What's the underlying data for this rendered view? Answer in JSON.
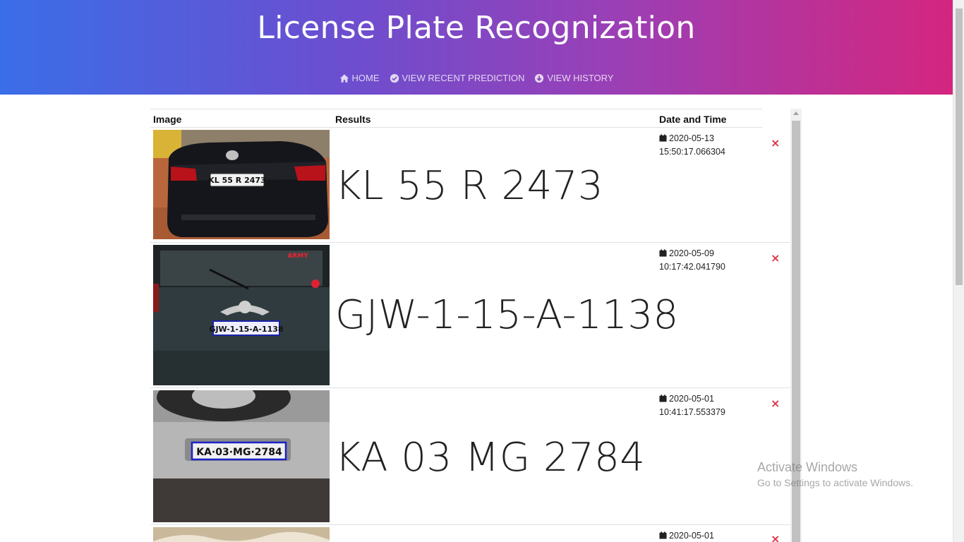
{
  "header": {
    "title": "License Plate Recognization",
    "nav": [
      {
        "label": "HOME",
        "icon": "home-icon"
      },
      {
        "label": "VIEW RECENT PREDICTION",
        "icon": "check-circle-icon"
      },
      {
        "label": "VIEW HISTORY",
        "icon": "arrow-circle-down-icon"
      }
    ]
  },
  "table": {
    "columns": [
      "Image",
      "Results",
      "Date and Time"
    ],
    "rows": [
      {
        "result": "KL 55 R 2473",
        "date": "2020-05-13",
        "time": "15:50:17.066304",
        "plate_text": "KL 55 R 2473",
        "car": "black sedan"
      },
      {
        "result": "GJW-1-15-A-1138",
        "date": "2020-05-09",
        "time": "10:17:42.041790",
        "plate_text": "GJW-1-15-A-1138",
        "car": "dark grey SUV"
      },
      {
        "result": "KA 03 MG 2784",
        "date": "2020-05-01",
        "time": "10:41:17.553379",
        "plate_text": "KA·03·MG·2784",
        "car": "silver SUV"
      },
      {
        "result": "",
        "date": "2020-05-01",
        "time": "",
        "plate_text": "",
        "car": ""
      }
    ]
  },
  "delete_icon": "×",
  "watermark": {
    "line1": "Activate Windows",
    "line2": "Go to Settings to activate Windows."
  },
  "colors": {
    "gradient_start": "#3a6ee8",
    "gradient_end": "#d4267f",
    "delete": "#dc3545"
  }
}
